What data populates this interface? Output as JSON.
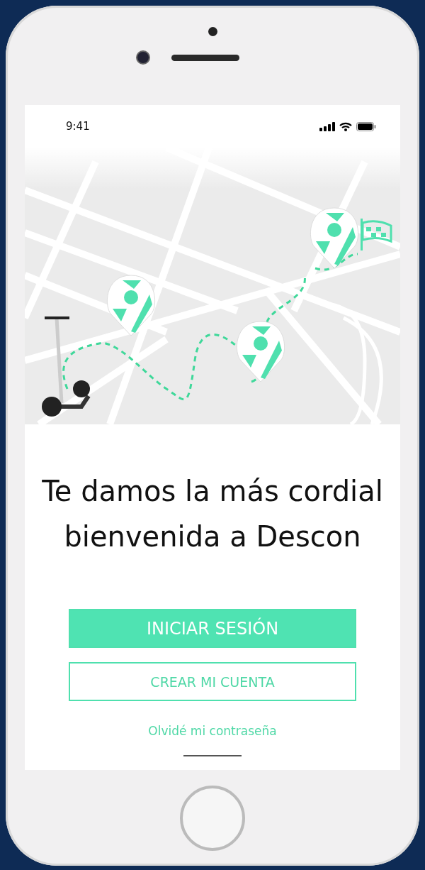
{
  "status_bar": {
    "time": "9:41"
  },
  "welcome_title": "Te damos la más cordial bienvenida a Descon",
  "buttons": [
    {
      "label": "INICIAR SESIÓN",
      "kind": "primary"
    },
    {
      "label": "CREAR MI CUENTA",
      "kind": "outline"
    }
  ],
  "forgot_password_link": "Olvidé mi contraseña"
}
